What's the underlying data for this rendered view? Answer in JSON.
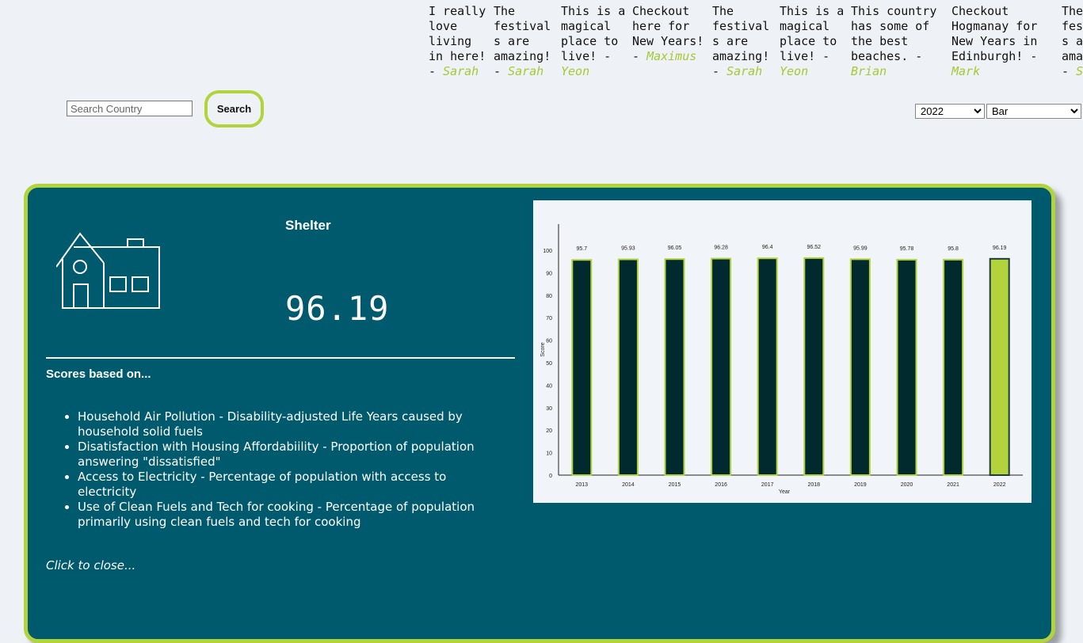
{
  "ticker": {
    "quotes": [
      {
        "text": "I really love living in here! -",
        "author": "Sarah"
      },
      {
        "text": "The festivals are amazing! -",
        "author": "Sarah"
      },
      {
        "text": "This is a magical place to live! -",
        "author": "Yeon"
      },
      {
        "text": "Checkout here for New Years! -",
        "author": "Maximus"
      },
      {
        "text": "The festivals are amazing! -",
        "author": "Sarah"
      },
      {
        "text": "This is a magical place to live! -",
        "author": "Yeon"
      },
      {
        "text": "This country has some of the best beaches. -",
        "author": "Brian"
      },
      {
        "text": "Checkout Hogmanay for New Years in Edinburgh! -",
        "author": "Mark"
      },
      {
        "text": "The festivals are amazing! -",
        "author": "Sarah"
      }
    ]
  },
  "search": {
    "placeholder": "Search Country",
    "button_label": "Search"
  },
  "filters": {
    "year_selected": "2022",
    "chart_type_selected": "Bar"
  },
  "card": {
    "title": "Shelter",
    "score": "96.19",
    "scores_heading": "Scores based on...",
    "criteria": [
      "Household Air Pollution - Disability-adjusted Life Years caused by household solid fuels",
      "Disatisfaction with Housing Affordabiility - Proportion of population answering \"dissatisfied\"",
      "Access to Electricity - Percentage of population with access to electricity",
      "Use of Clean Fuels and Tech for cooking - Percentage of population primarily using clean fuels and tech for cooking"
    ],
    "close_text": "Click to close..."
  },
  "colors": {
    "accent": "#b2d33b",
    "card_bg": "#005a6e",
    "bar_dark": "#002a2e",
    "bar_highlight": "#b2d33b"
  },
  "chart_data": {
    "type": "bar",
    "categories": [
      "2013",
      "2014",
      "2015",
      "2016",
      "2017",
      "2018",
      "2019",
      "2020",
      "2021",
      "2022"
    ],
    "values": [
      95.7,
      95.93,
      96.05,
      96.28,
      96.4,
      96.52,
      95.99,
      95.78,
      95.8,
      96.19
    ],
    "highlight": "2022",
    "xlabel": "Year",
    "ylabel": "Score",
    "ylim": [
      0,
      100
    ],
    "yticks": [
      0,
      10,
      20,
      30,
      40,
      50,
      60,
      70,
      80,
      90,
      100
    ]
  }
}
